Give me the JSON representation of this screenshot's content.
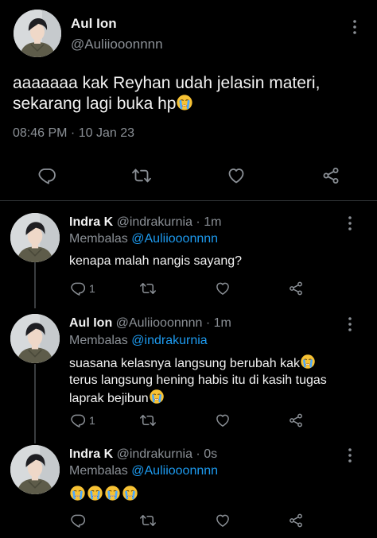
{
  "main_tweet": {
    "display_name": "Aul Ion",
    "handle": "@Auliiooonnnn",
    "text_line1": "aaaaaaa kak Reyhan udah jelasin materi,",
    "text_line2": "sekarang lagi buka hp",
    "emoji": "crying-face",
    "timestamp": "08:46 PM · 10 Jan 23"
  },
  "replies": [
    {
      "display_name": "Indra K",
      "handle": "@indrakurnia · 1m",
      "replying_prefix": "Membalas",
      "replying_to": "@Auliiooonnnn",
      "text": "kenapa malah nangis sayang?",
      "reply_count": "1"
    },
    {
      "display_name": "Aul Ion",
      "handle": "@Auliiooonnnn · 1m",
      "replying_prefix": "Membalas",
      "replying_to": "@indrakurnia",
      "text_line1": "suasana kelasnya langsung berubah kak",
      "text_line2": "terus langsung hening habis itu di kasih tugas",
      "text_line3": "laprak bejibun",
      "reply_count": "1"
    },
    {
      "display_name": "Indra K",
      "handle": "@indrakurnia · 0s",
      "replying_prefix": "Membalas",
      "replying_to": "@Auliiooonnnn",
      "emoji_count": 4
    }
  ],
  "colors": {
    "background": "#000000",
    "text": "#e7e9ea",
    "muted": "#8b9096",
    "link": "#1d9bf0"
  },
  "icons": [
    "reply-icon",
    "retweet-icon",
    "like-icon",
    "share-icon",
    "more-icon"
  ]
}
